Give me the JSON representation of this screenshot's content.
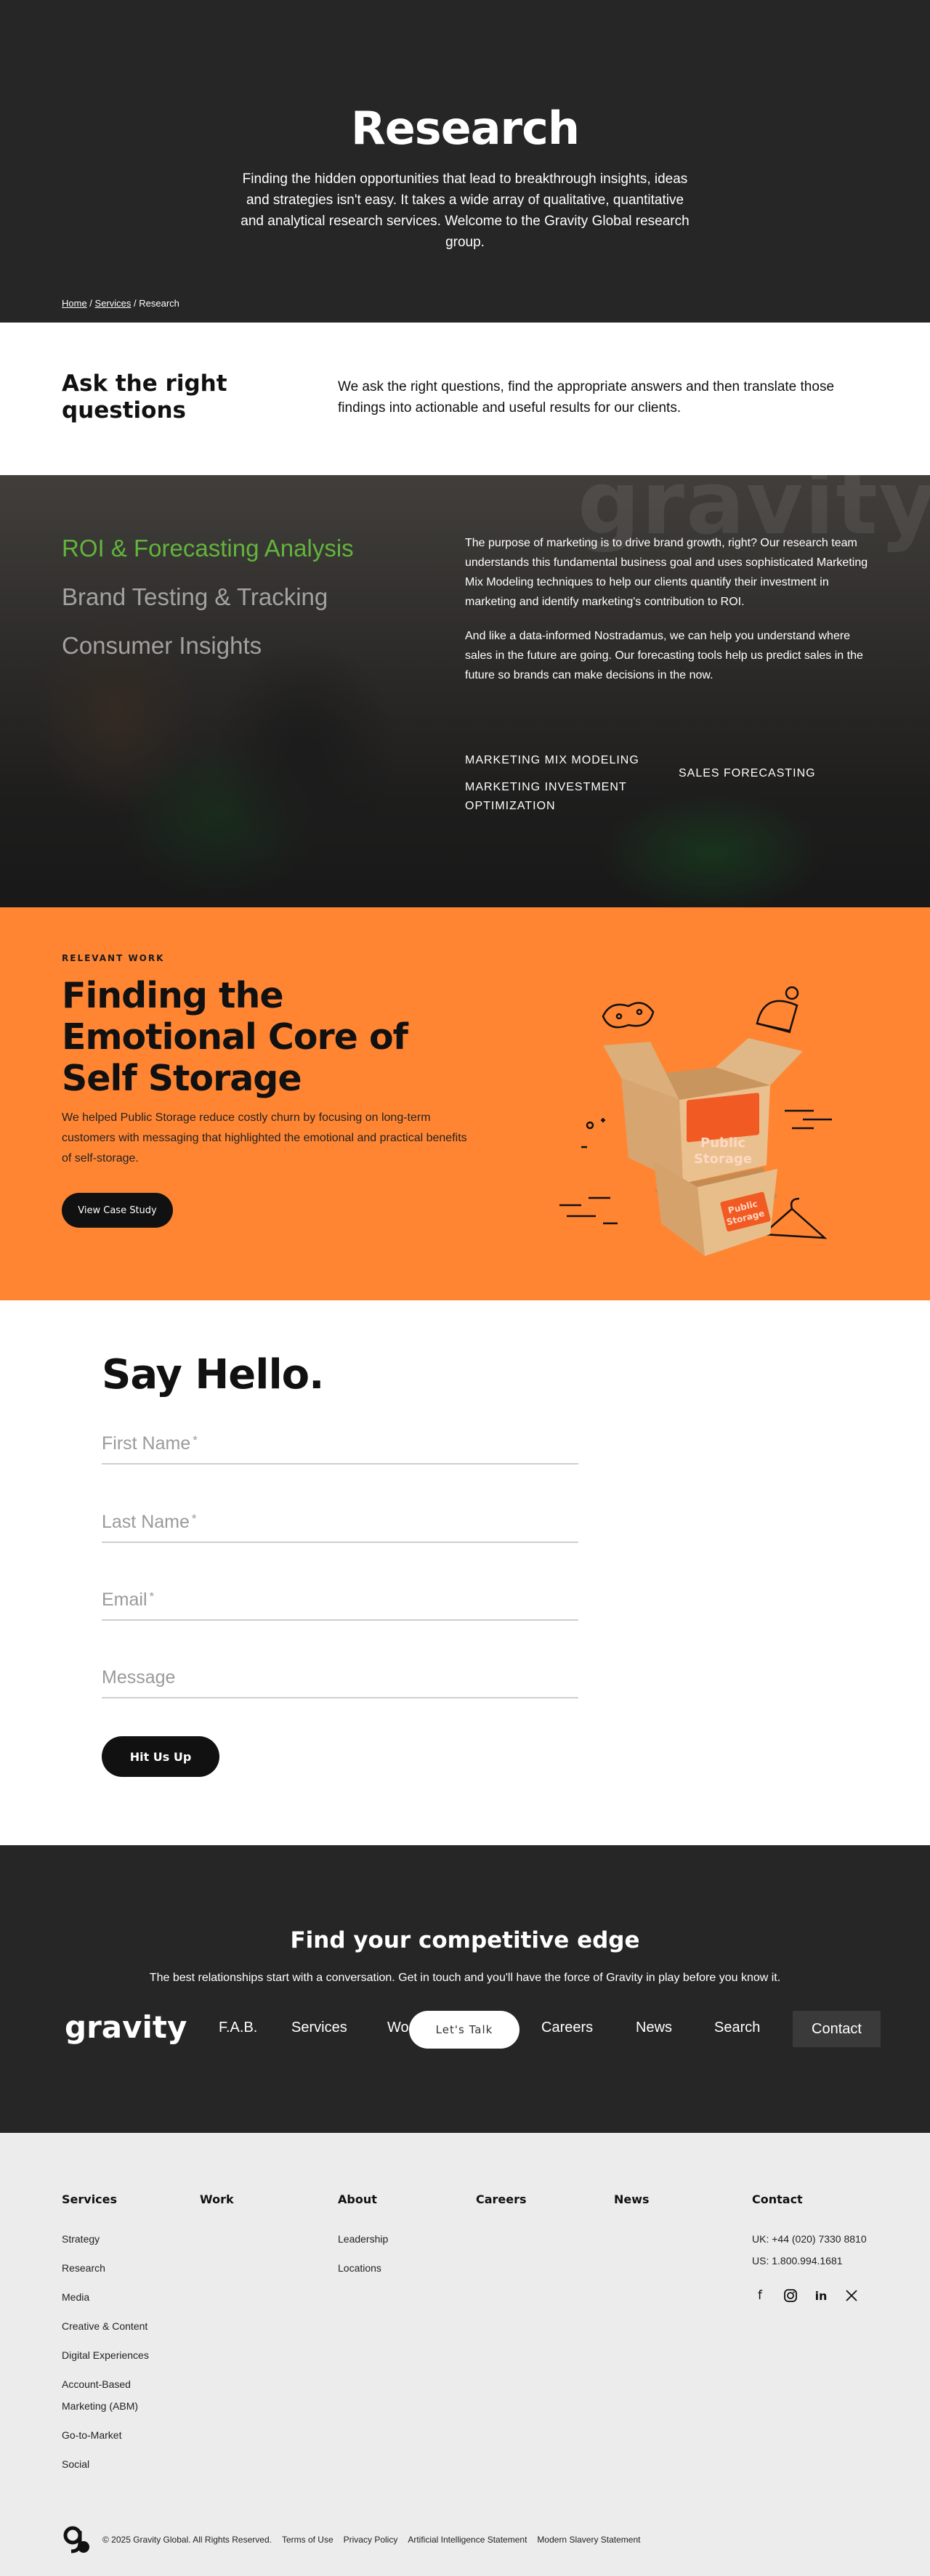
{
  "hero": {
    "title": "Research",
    "intro": "Finding the hidden opportunities that lead to breakthrough insights, ideas and strategies isn't easy. It takes a wide array of qualitative, quantitative and analytical research services. Welcome to the Gravity Global research group.",
    "breadcrumb": {
      "home": "Home",
      "sep1": " / ",
      "services": "Services",
      "sep2": " / ",
      "current": "Research"
    }
  },
  "ask": {
    "title": "Ask the right questions",
    "body": "We ask the right questions, find the appropriate answers and then translate those findings into actionable and useful results for our clients."
  },
  "capabilities": {
    "watermark": "gravity",
    "tabs": [
      {
        "label": "ROI & Forecasting Analysis",
        "active": true
      },
      {
        "label": "Brand Testing & Tracking",
        "active": false
      },
      {
        "label": "Consumer Insights",
        "active": false
      }
    ],
    "paragraphs": [
      "The purpose of marketing is to drive brand growth, right? Our research team understands this fundamental business goal and uses sophisticated Marketing Mix Modeling techniques to help our clients quantify their investment in marketing and identify marketing's contribution to ROI.",
      "And like a data-informed Nostradamus, we can help you understand where sales in the future are going. Our forecasting tools help us predict sales in the future so brands can make decisions in the now."
    ],
    "tags": [
      "MARKETING MIX MODELING",
      "MARKETING INVESTMENT OPTIMIZATION",
      "SALES FORECASTING"
    ],
    "active_color": "#62b43c"
  },
  "relevant": {
    "eyebrow": "RELEVANT WORK",
    "title": "Finding the Emotional Core of Self Storage",
    "body": "We helped Public Storage reduce costly churn by focusing on long-term customers with messaging that highlighted the emotional and practical benefits of self-storage.",
    "button": "View Case Study",
    "box_label_1": "Public",
    "box_label_2": "Storage",
    "bg_color": "#ff8533"
  },
  "form": {
    "title": "Say Hello.",
    "fields": [
      {
        "label": "First Name",
        "required": "*"
      },
      {
        "label": "Last Name",
        "required": "*"
      },
      {
        "label": "Email",
        "required": "*"
      },
      {
        "label": "Message",
        "required": ""
      }
    ],
    "submit": "Hit Us Up"
  },
  "cta": {
    "title": "Find your competitive edge",
    "body": "The best relationships start with a conversation. Get in touch and you'll have the force of Gravity in play before you know it.",
    "logo": "gravity",
    "nav": [
      "F.A.B.",
      "Services",
      "Wo",
      "Careers",
      "News",
      "Search"
    ],
    "contact": "Contact",
    "talk": "Let's Talk"
  },
  "footer": {
    "services": {
      "title": "Services",
      "links": [
        "Strategy",
        "Research",
        "Media",
        "Creative & Content",
        "Digital Experiences",
        "Account-Based Marketing (ABM)",
        "Go-to-Market",
        "Social"
      ]
    },
    "work": {
      "title": "Work"
    },
    "about": {
      "title": "About",
      "links": [
        "Leadership",
        "Locations"
      ]
    },
    "careers": {
      "title": "Careers"
    },
    "news": {
      "title": "News"
    },
    "contact": {
      "title": "Contact",
      "uk": "UK: +44 (020) 7330 8810",
      "us": "US: 1.800.994.1681"
    },
    "social_icons": [
      "facebook-icon",
      "instagram-icon",
      "linkedin-icon",
      "x-icon"
    ],
    "copyright": "© 2025 Gravity Global. All Rights Reserved.",
    "legal": [
      "Terms of Use",
      "Privacy Policy",
      "Artificial Intelligence Statement",
      "Modern Slavery Statement"
    ]
  }
}
